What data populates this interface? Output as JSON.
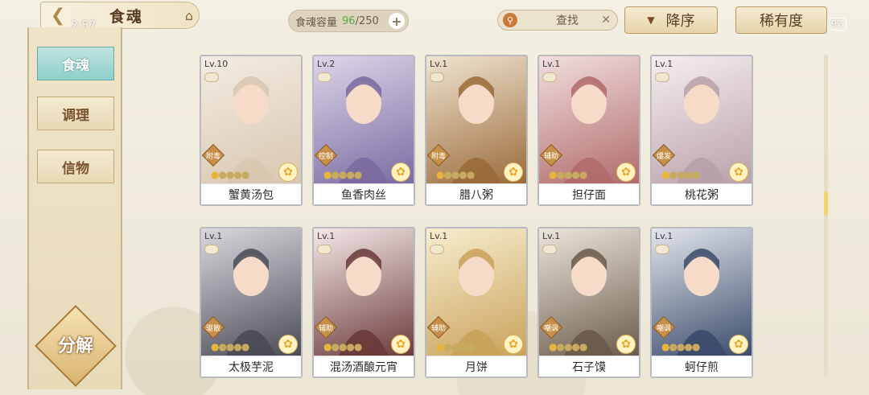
{
  "status": {
    "time": "2:57",
    "battery": "92"
  },
  "header": {
    "title": "食魂",
    "capacity_label": "食魂容量",
    "capacity_current": "96",
    "capacity_total": "/250",
    "search_label": "查找",
    "sort_label": "降序",
    "filter_label": "稀有度"
  },
  "sidebar": {
    "tabs": [
      {
        "label": "食魂"
      },
      {
        "label": "调理"
      },
      {
        "label": "信物"
      }
    ],
    "decompose_label": "分解"
  },
  "cards": [
    {
      "level": "Lv.10",
      "role": "附毒",
      "name": "蟹黄汤包",
      "colors": [
        "#f3ece2",
        "#d8c6b0"
      ]
    },
    {
      "level": "Lv.2",
      "role": "控制",
      "name": "鱼香肉丝",
      "colors": [
        "#dcd6ea",
        "#7a6aa0"
      ]
    },
    {
      "level": "Lv.1",
      "role": "附毒",
      "name": "腊八粥",
      "colors": [
        "#f0e4d0",
        "#9a6a3a"
      ]
    },
    {
      "level": "Lv.1",
      "role": "辅助",
      "name": "担仔面",
      "colors": [
        "#f2dede",
        "#b06a6a"
      ]
    },
    {
      "level": "Lv.1",
      "role": "爆发",
      "name": "桃花粥",
      "colors": [
        "#f6eef0",
        "#b8a0a8"
      ]
    },
    {
      "level": "Lv.1",
      "role": "驱散",
      "name": "太极芋泥",
      "colors": [
        "#dad8de",
        "#4a4a55"
      ]
    },
    {
      "level": "Lv.1",
      "role": "辅助",
      "name": "混汤酒酿元宵",
      "colors": [
        "#f6e8e8",
        "#6a3a3a"
      ]
    },
    {
      "level": "Lv.1",
      "role": "辅助",
      "name": "月饼",
      "colors": [
        "#f8edcf",
        "#c8a25a"
      ]
    },
    {
      "level": "Lv.1",
      "role": "嘲讽",
      "name": "石子馍",
      "colors": [
        "#ece6dc",
        "#6a5a4a"
      ]
    },
    {
      "level": "Lv.1",
      "role": "嘲讽",
      "name": "蚵仔煎",
      "colors": [
        "#e2e6ec",
        "#3a4a6a"
      ]
    }
  ]
}
